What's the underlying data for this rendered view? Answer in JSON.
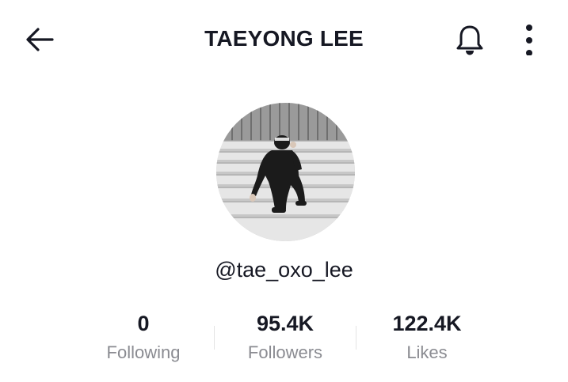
{
  "header": {
    "title": "TAEYONG LEE",
    "back_icon": "arrow-left-icon",
    "bell_icon": "bell-icon",
    "more_icon": "more-vertical-icon"
  },
  "profile": {
    "username": "@tae_oxo_lee",
    "avatar_icon": "profile-photo"
  },
  "stats": [
    {
      "value": "0",
      "label": "Following"
    },
    {
      "value": "95.4K",
      "label": "Followers"
    },
    {
      "value": "122.4K",
      "label": "Likes"
    }
  ],
  "colors": {
    "text_primary": "#161823",
    "text_secondary": "#8a8b91",
    "divider": "#e3e3e4",
    "background": "#ffffff"
  }
}
